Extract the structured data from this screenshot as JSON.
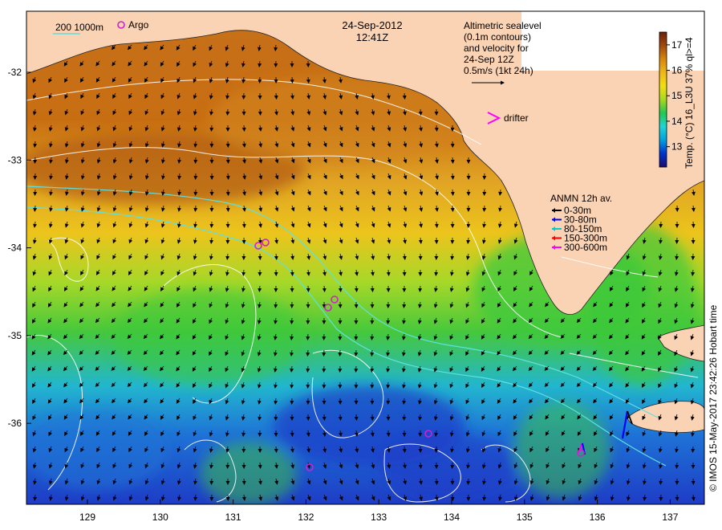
{
  "header": {
    "date": "24-Sep-2012",
    "time": "12:41Z"
  },
  "legend_topleft": {
    "isobath_label": "200  1000m",
    "argo_label": "Argo"
  },
  "altimetry_note": {
    "lines": [
      "Altimetric sealevel",
      "(0.1m contours)",
      "and velocity for",
      "24-Sep 12Z"
    ],
    "scale_label": "0.5m/s (1kt 24h)"
  },
  "drifter_label": "drifter",
  "anmn": {
    "title": "ANMN 12h av.",
    "items": [
      {
        "label": "0-30m",
        "color": "#000000"
      },
      {
        "label": "30-80m",
        "color": "#0000ff"
      },
      {
        "label": "80-150m",
        "color": "#00cccc"
      },
      {
        "label": "150-300m",
        "color": "#ff0000"
      },
      {
        "label": "300-600m",
        "color": "#ff00ff"
      }
    ]
  },
  "colorbar": {
    "title": "Temp. (°C) 16_L3U 37% ql>=4",
    "ticks": [
      "13",
      "14",
      "15",
      "16",
      "17"
    ],
    "range": [
      12.2,
      17.5
    ],
    "colors": [
      "#1a0a6e",
      "#0033cc",
      "#00a0e0",
      "#22d4d4",
      "#22c850",
      "#a8d81e",
      "#f0e010",
      "#f0b818",
      "#d8860c",
      "#a04a10",
      "#6e1e0a"
    ]
  },
  "credit": "© IMOS 15-May-2017 23:42:26 Hobart time",
  "axes": {
    "x_ticks": [
      "129",
      "130",
      "131",
      "132",
      "133",
      "134",
      "135",
      "136",
      "137"
    ],
    "y_ticks": [
      "-32",
      "-33",
      "-34",
      "-35",
      "-36"
    ]
  },
  "colors": {
    "land": "#fad2b4",
    "water_warm": "#d88418",
    "water_mid": "#e8c818",
    "water_green": "#3cc83c",
    "water_cool": "#1eb4d2",
    "water_cold": "#1e3cc8",
    "argo": "#d020d0"
  }
}
